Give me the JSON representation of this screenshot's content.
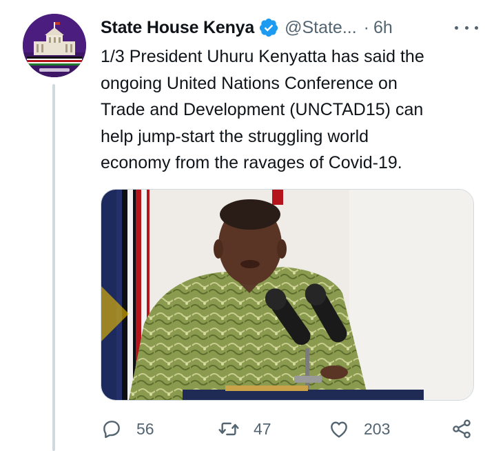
{
  "tweet": {
    "author": {
      "name": "State House Kenya",
      "handle": "@State...",
      "verified": true,
      "avatar_caption": "@StateHouseKenya"
    },
    "time_separator": "·",
    "time": "6h",
    "text_lines": [
      "1/3 President Uhuru Kenyatta has said the",
      "ongoing United Nations Conference on",
      "Trade and Development (UNCTAD15) can",
      "help jump-start the struggling world",
      "economy from the ravages of Covid-19."
    ],
    "actions": {
      "replies": "56",
      "retweets": "47",
      "likes": "203"
    }
  },
  "icons": {
    "verified": "verified-badge-icon",
    "more": "more-options-icon",
    "reply": "reply-icon",
    "retweet": "retweet-icon",
    "like": "heart-icon",
    "share": "share-icon"
  },
  "colors": {
    "text": "#0f1419",
    "secondary": "#536471",
    "verified": "#1d9bf0",
    "thread_line": "#cfd9de"
  }
}
